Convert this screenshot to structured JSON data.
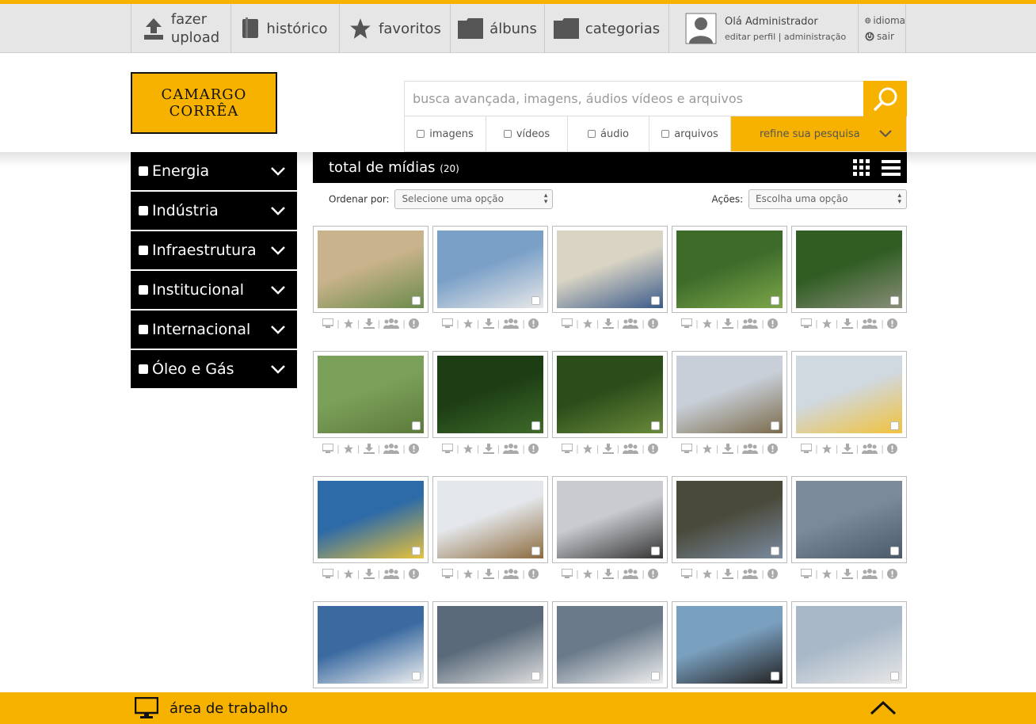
{
  "topnav": {
    "upload": {
      "line1": "fazer",
      "line2": "upload"
    },
    "history": "histórico",
    "favorites": "favoritos",
    "albums": "álbuns",
    "categories": "categorias",
    "user": {
      "greeting": "Olá Administrador",
      "edit_profile": "editar perfil",
      "separator": "|",
      "admin": "administração"
    },
    "language": "idioma",
    "logout": "sair"
  },
  "logo": {
    "line1": "CAMARGO",
    "line2": "CORRÊA"
  },
  "search": {
    "placeholder": "busca avançada, imagens, áudios vídeos e arquivos",
    "filters": [
      "imagens",
      "vídeos",
      "áudio",
      "arquivos"
    ],
    "refine": "refine sua pesquisa"
  },
  "sidebar": {
    "categories": [
      "Energia",
      "Indústria",
      "Infraestrutura",
      "Institucional",
      "Internacional",
      "Óleo e Gás"
    ]
  },
  "main": {
    "title": "total de mídias",
    "count": "(20)",
    "sort_label": "Ordenar por:",
    "sort_value": "Selecione uma opção",
    "actions_label": "Ações:",
    "actions_value": "Escolha uma opção"
  },
  "colors": {
    "accent": "#f7b200",
    "dark": "#000000"
  },
  "thumbnails": [
    [
      "#c9b38c",
      "#6a8a4a"
    ],
    [
      "#7aa0c8",
      "#e8e8e8"
    ],
    [
      "#d9d4c4",
      "#3a5a8a"
    ],
    [
      "#3c6b2a",
      "#7da64a"
    ],
    [
      "#2f5d22",
      "#8a8e7a"
    ],
    [
      "#7ba05a",
      "#5c7a3a"
    ],
    [
      "#1d3d14",
      "#3f6b2a"
    ],
    [
      "#2a4d1a",
      "#6a8a3a"
    ],
    [
      "#c8cfd8",
      "#7a6a4a"
    ],
    [
      "#d0d8e0",
      "#f1c23a"
    ],
    [
      "#2d6aa8",
      "#e9c23a"
    ],
    [
      "#e3e6ea",
      "#8c6a3c"
    ],
    [
      "#c9cbd0",
      "#333"
    ],
    [
      "#4a4a3a",
      "#7a8aa0"
    ],
    [
      "#7a8a9a",
      "#4a5a6a"
    ],
    [
      "#3a6aa0",
      "#f0f0f0"
    ],
    [
      "#5a6a7a",
      "#e0e0e0"
    ],
    [
      "#6a7a8a",
      "#f0f0f0"
    ],
    [
      "#7aa0c0",
      "#222"
    ],
    [
      "#a8b8c8",
      "#e8e8e8"
    ]
  ],
  "footer": {
    "label": "área de trabalho"
  }
}
